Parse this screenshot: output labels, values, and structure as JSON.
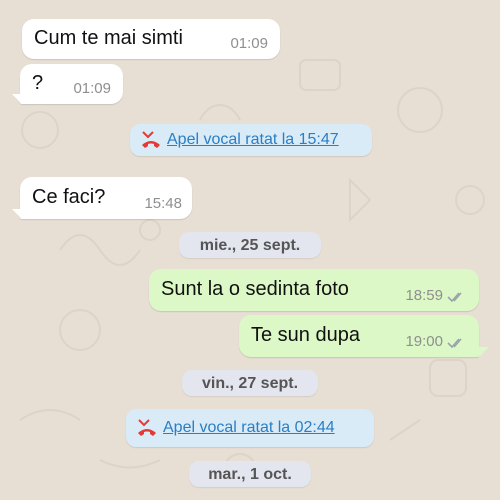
{
  "messages_incoming": [
    {
      "text": "Cum te mai simti",
      "time": "01:09"
    },
    {
      "text": "?",
      "time": "01:09"
    },
    {
      "text": "Ce faci?",
      "time": "15:48"
    }
  ],
  "messages_outgoing": [
    {
      "text": "Sunt la o sedinta foto",
      "time": "18:59"
    },
    {
      "text": "Te sun dupa",
      "time": "19:00"
    }
  ],
  "missed_calls": [
    {
      "label": "Apel vocal ratat la 15:47"
    },
    {
      "label": "Apel vocal ratat la 02:44"
    }
  ],
  "date_separators": [
    "mie., 25 sept.",
    "vin., 27 sept.",
    "mar., 1 oct."
  ],
  "colors": {
    "chat_background": "#e7ded4",
    "incoming_bubble": "#ffffff",
    "outgoing_bubble": "#dcf8c6",
    "call_bubble": "#d8ebf7",
    "link": "#2a7ec6",
    "missed_call_icon": "#e53935",
    "read_checks": "#9aa3a8"
  },
  "icons": {
    "missed_call": "missed-call-icon",
    "read_receipt": "double-check-icon"
  }
}
